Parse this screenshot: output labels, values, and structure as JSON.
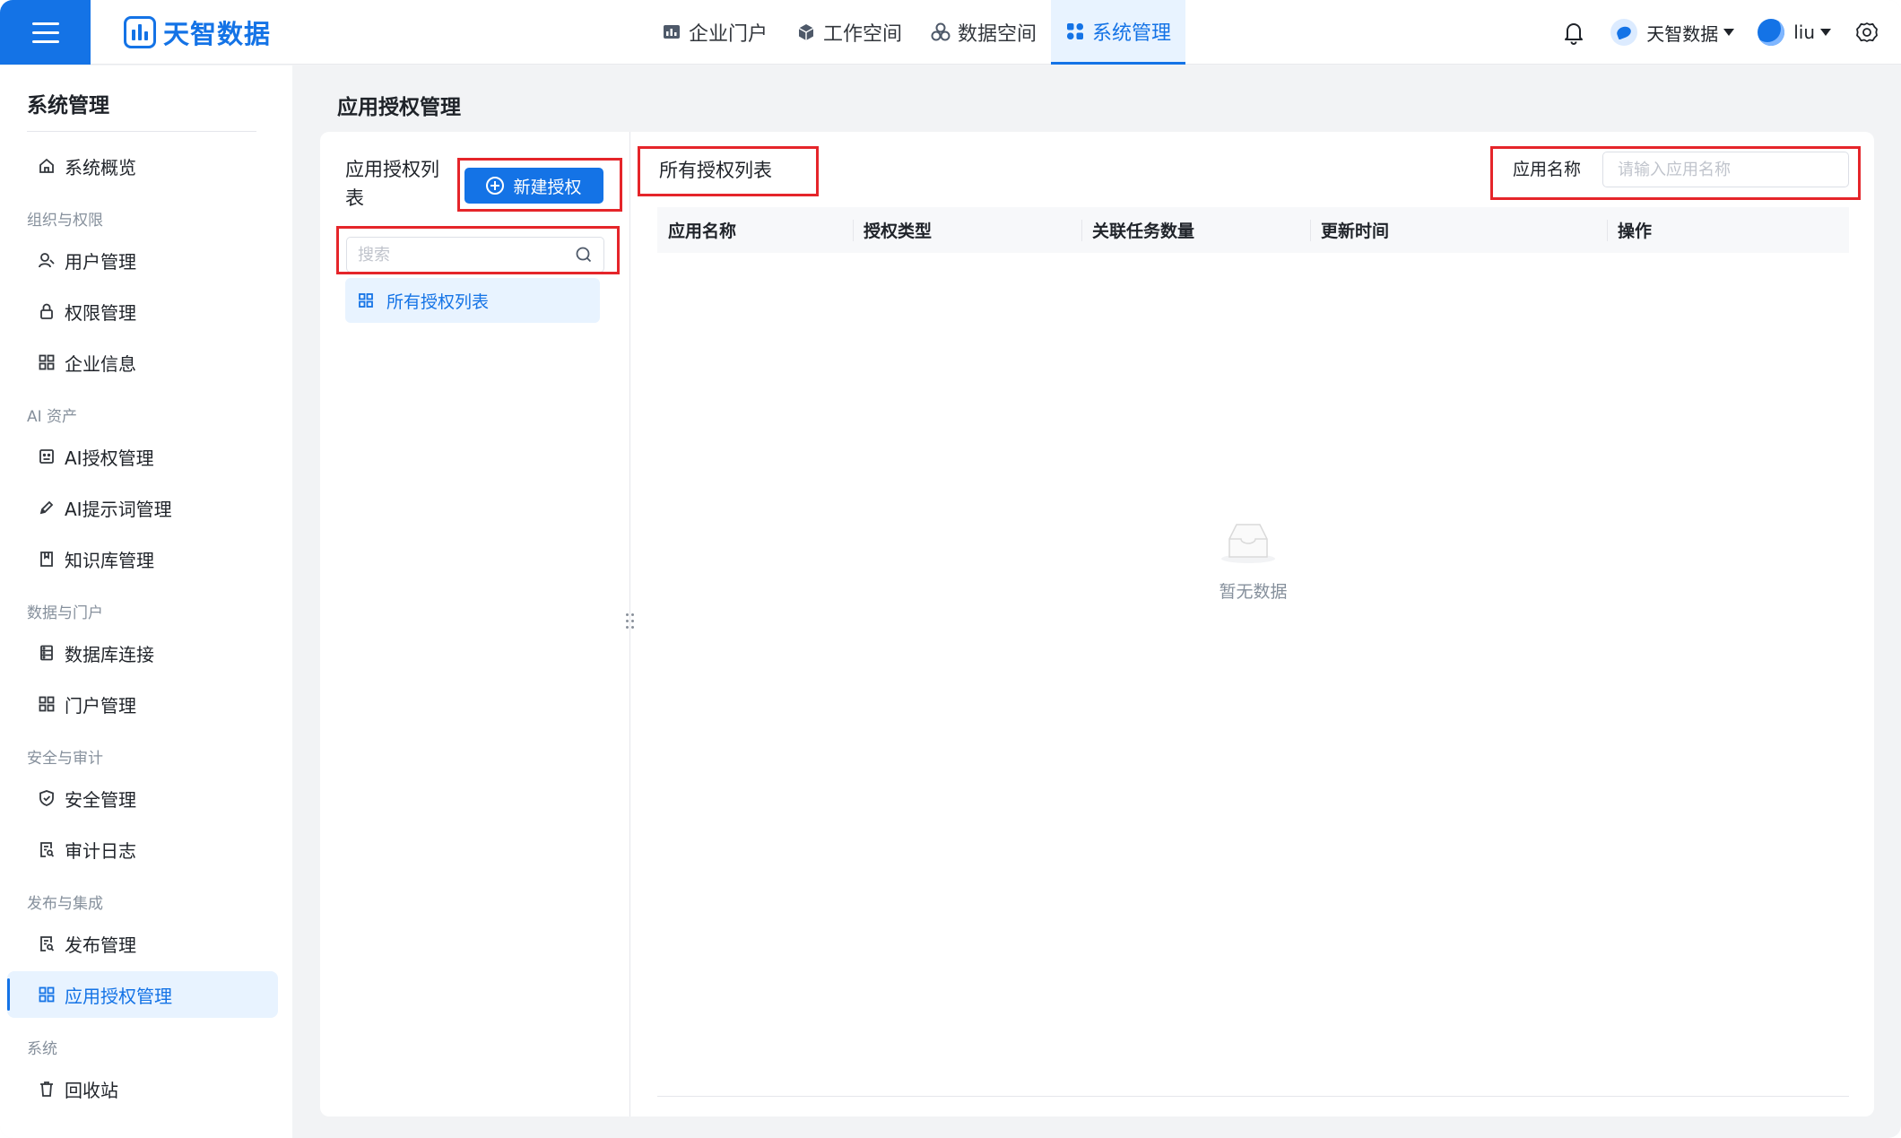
{
  "app": {
    "logo_text": "天智数据"
  },
  "top_nav": {
    "items": [
      {
        "label": "企业门户",
        "icon": "bar-chart-icon",
        "active": false
      },
      {
        "label": "工作空间",
        "icon": "cube-icon",
        "active": false
      },
      {
        "label": "数据空间",
        "icon": "cubes-icon",
        "active": false
      },
      {
        "label": "系统管理",
        "icon": "grid-icon",
        "active": true
      }
    ]
  },
  "header_right": {
    "org_name": "天智数据",
    "user_name": "liu"
  },
  "sidebar": {
    "title": "系统管理",
    "groups": {
      "org": "组织与权限",
      "ai": "AI 资产",
      "data": "数据与门户",
      "security": "安全与审计",
      "release": "发布与集成",
      "system": "系统"
    },
    "items": {
      "overview": "系统概览",
      "users": "用户管理",
      "permissions": "权限管理",
      "enterprise": "企业信息",
      "ai_auth": "AI授权管理",
      "ai_prompt": "AI提示词管理",
      "knowledge": "知识库管理",
      "db_conn": "数据库连接",
      "portal": "门户管理",
      "security": "安全管理",
      "audit": "审计日志",
      "release": "发布管理",
      "app_auth": "应用授权管理",
      "recycle": "回收站"
    },
    "active_item": "app_auth"
  },
  "main": {
    "page_title": "应用授权管理",
    "left_panel": {
      "title": "应用授权列表",
      "new_button": "新建授权",
      "search_placeholder": "搜索",
      "search_value": "",
      "list_items": [
        "所有授权列表"
      ]
    },
    "right_panel": {
      "title": "所有授权列表",
      "filter_label": "应用名称",
      "filter_placeholder": "请输入应用名称",
      "filter_value": "",
      "columns": [
        "应用名称",
        "授权类型",
        "关联任务数量",
        "更新时间",
        "操作"
      ],
      "rows": [],
      "empty_text": "暂无数据"
    }
  },
  "colors": {
    "primary": "#1473e6",
    "active_bg": "#e8f3ff",
    "annotation": "#e5252a"
  }
}
